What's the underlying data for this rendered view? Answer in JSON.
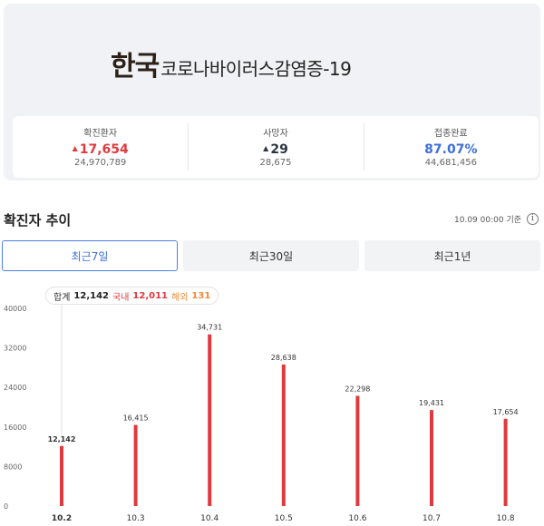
{
  "header": {
    "title_main": "한국",
    "title_sub": "코로나바이러스감염증-19"
  },
  "stats": [
    {
      "label": "확진환자",
      "value": "17,654",
      "sub": "24,970,789",
      "trend": "up",
      "color": "#e0393e"
    },
    {
      "label": "사망자",
      "value": "29",
      "sub": "28,675",
      "trend": "up",
      "color": "#2d3642"
    },
    {
      "label": "접종완료",
      "value": "87.07%",
      "sub": "44,681,456",
      "trend": "none",
      "color": "#3d6fd8"
    }
  ],
  "trend_section": {
    "title": "확진자 추이",
    "timestamp": "10.09 00:00 기준",
    "info_icon": "info-icon",
    "tabs": [
      {
        "label": "최근7일",
        "active": true
      },
      {
        "label": "최근30일",
        "active": false
      },
      {
        "label": "최근1년",
        "active": false
      }
    ]
  },
  "tooltip": {
    "total_label": "합계",
    "total_value": "12,142",
    "domestic_label": "국내",
    "domestic_value": "12,011",
    "overseas_label": "해외",
    "overseas_value": "131"
  },
  "chart_data": {
    "type": "bar",
    "categories": [
      "10.2",
      "10.3",
      "10.4",
      "10.5",
      "10.6",
      "10.7",
      "10.8"
    ],
    "values": [
      12142,
      16415,
      34731,
      28638,
      22298,
      19431,
      17654
    ],
    "value_labels": [
      "12,142",
      "16,415",
      "34,731",
      "28,638",
      "22,298",
      "19,431",
      "17,654"
    ],
    "ylim": [
      0,
      40000
    ],
    "yticks": [
      "0",
      "8000",
      "16000",
      "24000",
      "32000",
      "40000"
    ],
    "ytick_values": [
      0,
      8000,
      16000,
      24000,
      32000,
      40000
    ],
    "selected_index": 0,
    "bar_color": "#e0393e",
    "grid": false,
    "title": "",
    "xlabel": "",
    "ylabel": ""
  }
}
